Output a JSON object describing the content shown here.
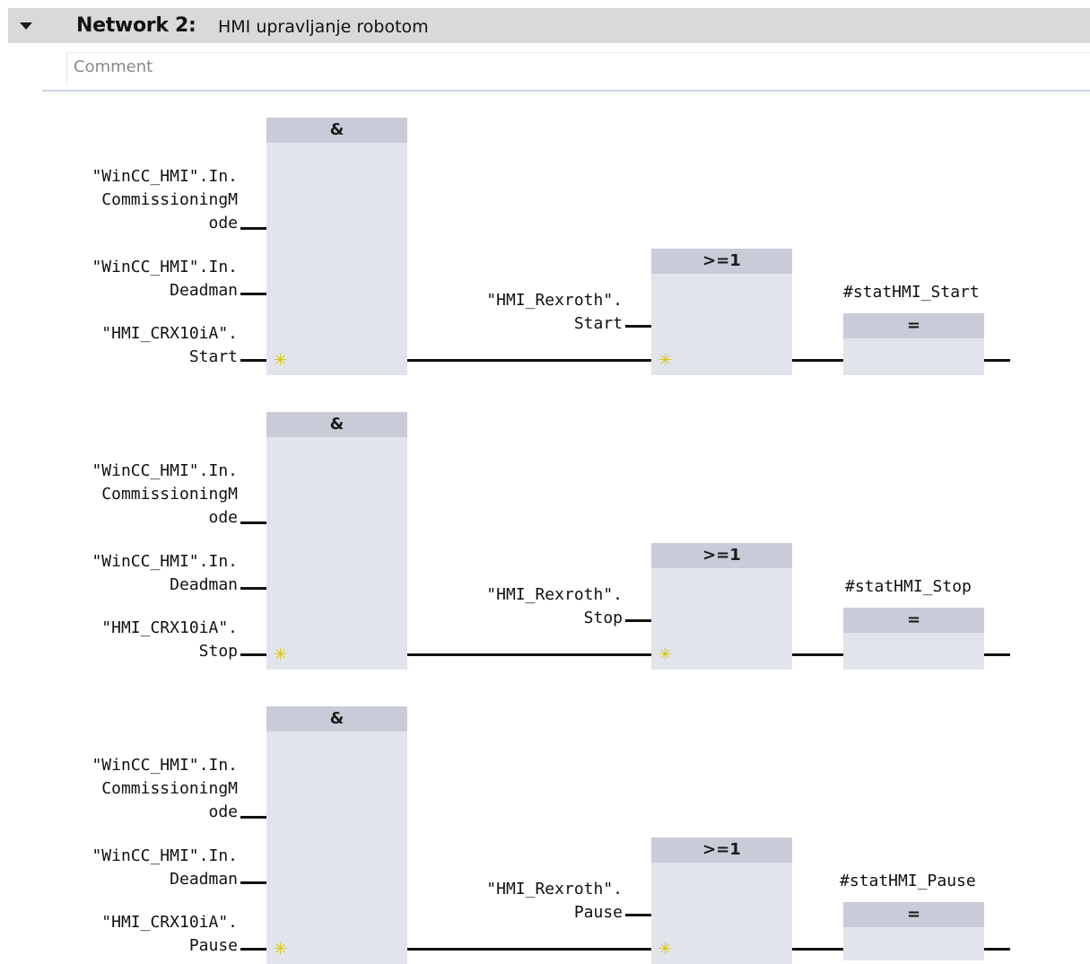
{
  "network": {
    "label": "Network 2:",
    "title": "HMI upravljanje robotom",
    "comment_placeholder": "Comment"
  },
  "rungs": [
    {
      "and_symbol": "&",
      "or_symbol": ">=1",
      "coil_symbol": "=",
      "input1": [
        "\"WinCC_HMI\".In.",
        "CommissioningM",
        "ode"
      ],
      "input2": [
        "\"WinCC_HMI\".In.",
        "Deadman"
      ],
      "input3": [
        "\"HMI_CRX10iA\".",
        "Start"
      ],
      "or_input": [
        "\"HMI_Rexroth\".",
        "Start"
      ],
      "coil_tag": "#statHMI_Start"
    },
    {
      "and_symbol": "&",
      "or_symbol": ">=1",
      "coil_symbol": "=",
      "input1": [
        "\"WinCC_HMI\".In.",
        "CommissioningM",
        "ode"
      ],
      "input2": [
        "\"WinCC_HMI\".In.",
        "Deadman"
      ],
      "input3": [
        "\"HMI_CRX10iA\".",
        "Stop"
      ],
      "or_input": [
        "\"HMI_Rexroth\".",
        "Stop"
      ],
      "coil_tag": "#statHMI_Stop"
    },
    {
      "and_symbol": "&",
      "or_symbol": ">=1",
      "coil_symbol": "=",
      "input1": [
        "\"WinCC_HMI\".In.",
        "CommissioningM",
        "ode"
      ],
      "input2": [
        "\"WinCC_HMI\".In.",
        "Deadman"
      ],
      "input3": [
        "\"HMI_CRX10iA\".",
        "Pause"
      ],
      "or_input": [
        "\"HMI_Rexroth\".",
        "Pause"
      ],
      "coil_tag": "#statHMI_Pause"
    }
  ],
  "icons": {
    "collapse": "chevron-down-icon",
    "add_input": "add-input-star-icon"
  }
}
